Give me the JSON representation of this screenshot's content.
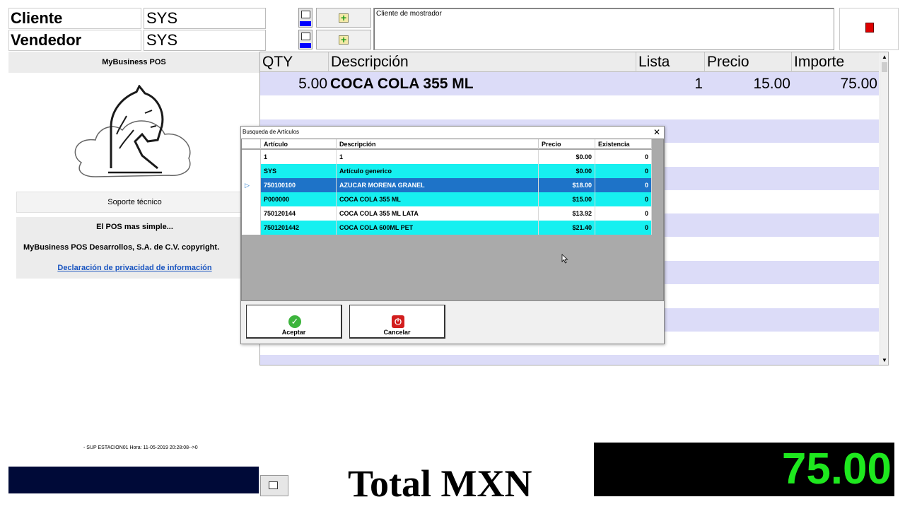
{
  "header": {
    "client_label": "Cliente",
    "client_value": "SYS",
    "seller_label": "Vendedor",
    "seller_value": "SYS",
    "notes": "Cliente de mostrador"
  },
  "left_panel": {
    "title": "MyBusiness POS",
    "support_button": "Soporte técnico",
    "slogan": "El POS mas simple...",
    "copyright": "MyBusiness POS Desarrollos, S.A. de C.V. copyright.",
    "privacy_link": "Declaración de privacidad de información"
  },
  "sales_grid": {
    "columns": [
      "QTY",
      "Descripción",
      "Lista",
      "Precio",
      "Importe"
    ],
    "rows": [
      {
        "qty": "5.00",
        "description": "COCA COLA 355 ML",
        "list": "1",
        "price": "15.00",
        "amount": "75.00"
      }
    ]
  },
  "dialog": {
    "title": "Busqueda de Artículos",
    "close_glyph": "✕",
    "columns": [
      "Artículo",
      "Descripción",
      "Precio",
      "Existencia"
    ],
    "rows": [
      {
        "code": "1",
        "description": "1",
        "price": "$0.00",
        "stock": "0"
      },
      {
        "code": "SYS",
        "description": "Artículo generico",
        "price": "$0.00",
        "stock": "0"
      },
      {
        "code": "750100100",
        "description": "AZUCAR MORENA GRANEL",
        "price": "$18.00",
        "stock": "0"
      },
      {
        "code": "P000000",
        "description": "COCA COLA 355 ML",
        "price": "$15.00",
        "stock": "0"
      },
      {
        "code": "750120144",
        "description": "COCA COLA 355 ML LATA",
        "price": "$13.92",
        "stock": "0"
      },
      {
        "code": "7501201442",
        "description": "COCA COLA 600ML PET",
        "price": "$21.40",
        "stock": "0"
      }
    ],
    "selected_marker": "▷",
    "accept_label": "Aceptar",
    "cancel_label": "Cancelar"
  },
  "footer": {
    "status": "- SUP ESTACION01 Hora: 11-05-2019 20:28:08-->0",
    "total_label": "Total MXN",
    "total_value": "75.00"
  },
  "colors": {
    "row_alt": "#dcdcf8",
    "dialog_cyan": "#16f0f0",
    "dialog_selected": "#1e73c8",
    "total_green": "#1ee81e",
    "navy": "#000a38"
  },
  "icons": [
    "search-icon",
    "add-icon",
    "exit-door-icon",
    "logo-horse",
    "check-icon",
    "power-icon",
    "cursor-icon"
  ]
}
